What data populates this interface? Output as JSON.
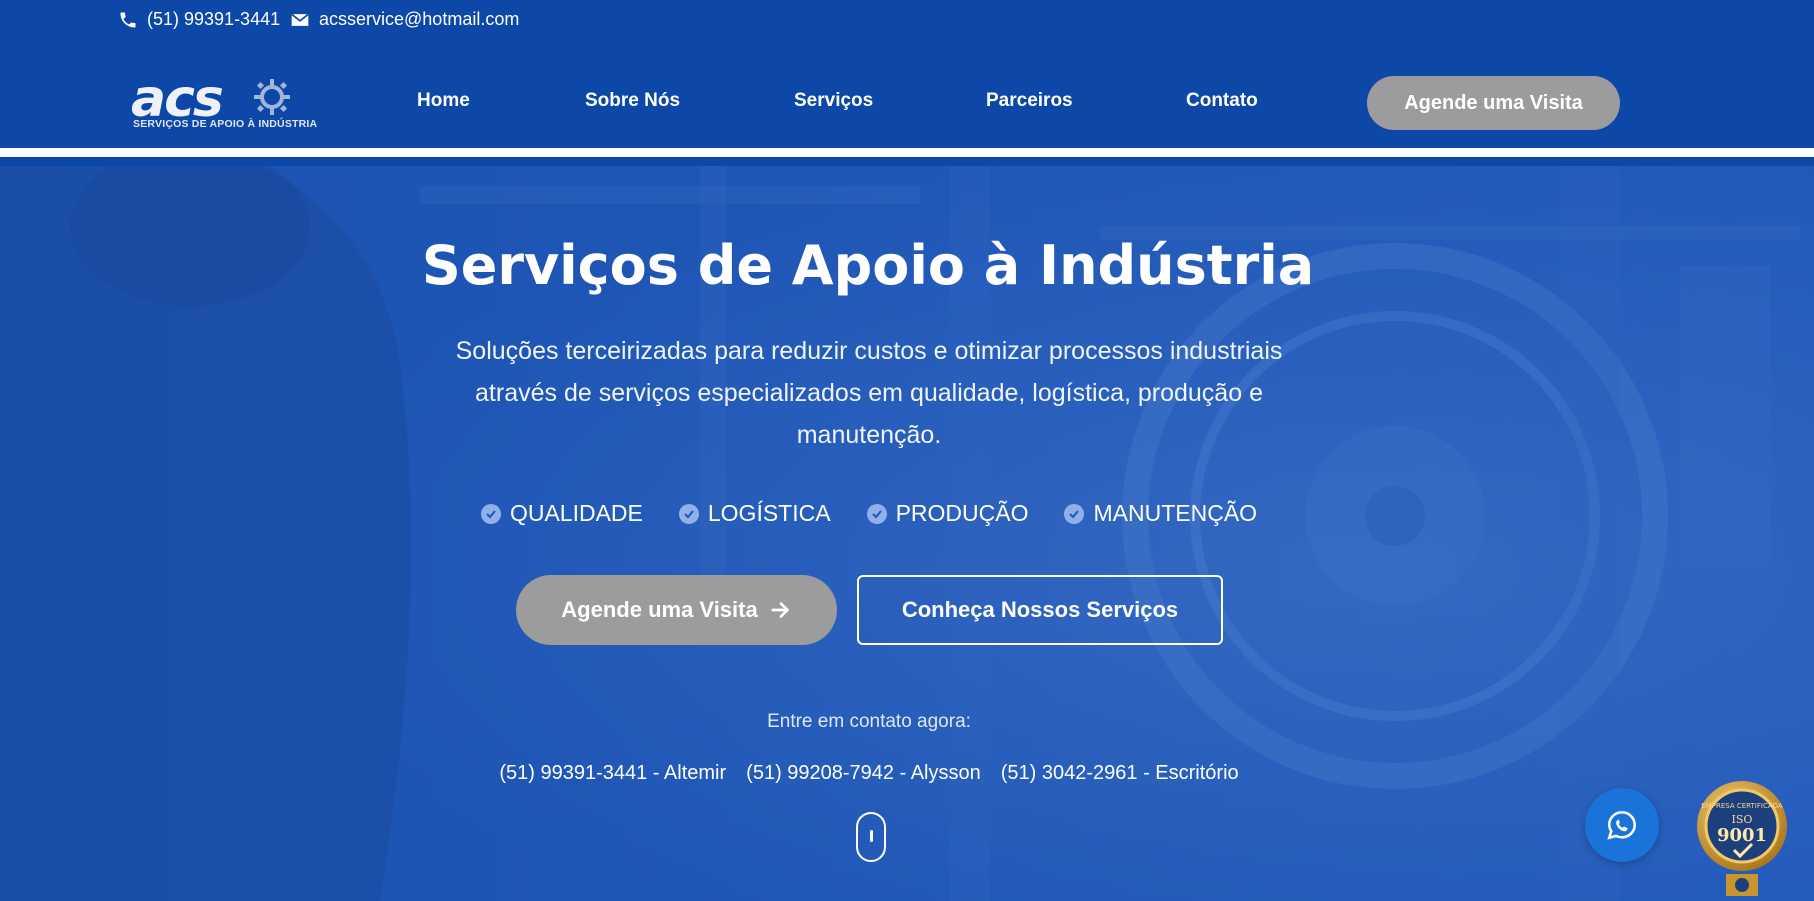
{
  "topbar": {
    "phone": "(51) 99391-3441",
    "email": "acsservice@hotmail.com",
    "phone_icon": "phone-icon",
    "email_icon": "envelope-icon"
  },
  "header": {
    "logo_text": "acs",
    "logo_subtitle": "SERVIÇOS DE APOIO À INDÚSTRIA",
    "nav": [
      "Home",
      "Sobre Nós",
      "Serviços",
      "Parceiros",
      "Contato"
    ],
    "cta": "Agende uma Visita"
  },
  "hero": {
    "title": "Serviços de Apoio à Indústria",
    "subtitle": "Soluções terceirizadas para reduzir custos e otimizar processos industriais através de serviços especializados em qualidade, logística, produção e manutenção.",
    "tags": [
      "QUALIDADE",
      "LOGÍSTICA",
      "PRODUÇÃO",
      "MANUTENÇÃO"
    ],
    "primary_button": "Agende uma Visita",
    "secondary_button": "Conheça Nossos Serviços",
    "contact_lead": "Entre em contato agora:",
    "contacts": [
      "(51) 99391-3441 - Altemir",
      "(51) 99208-7942 - Alysson",
      "(51) 3042-2961 - Escritório"
    ]
  },
  "badge": {
    "iso_line1": "EMPRESA CERTIFICADA",
    "iso_line2": "ISO",
    "iso_number": "9001"
  },
  "colors": {
    "brand_blue": "#0d47a8",
    "hero_overlay": "#1d56b8",
    "button_gray": "#9c9c9c",
    "whatsapp_blue": "#1a73d9",
    "badge_gold": "#c9962e"
  }
}
